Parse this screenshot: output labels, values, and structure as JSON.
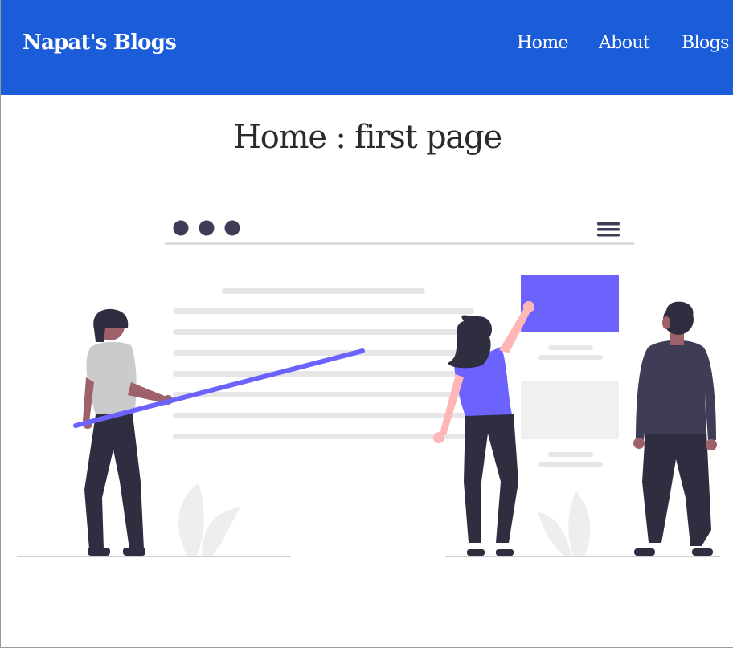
{
  "navbar": {
    "brand": "Napat's Blogs",
    "links": [
      {
        "label": "Home"
      },
      {
        "label": "About"
      },
      {
        "label": "Blogs"
      }
    ],
    "background": "#1b5cd9"
  },
  "main": {
    "title": "Home : first page",
    "illustration": {
      "icon": "people-building-website-illustration",
      "accent_color": "#6c63ff"
    }
  }
}
